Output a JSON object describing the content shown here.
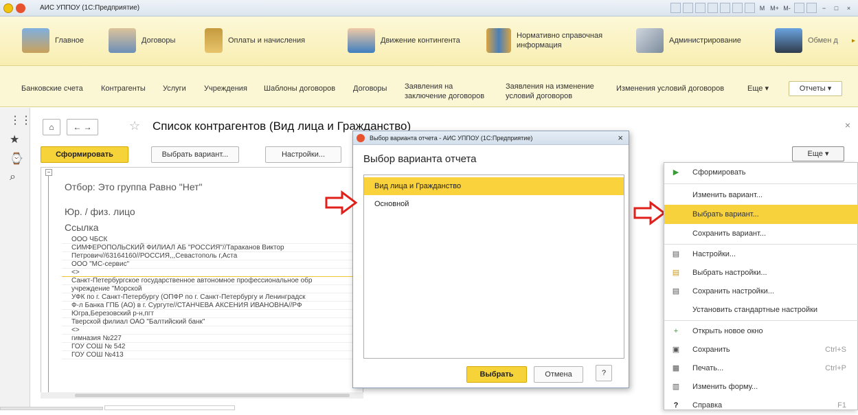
{
  "window": {
    "title": "АИС УППОУ  (1С:Предприятие)"
  },
  "toolbar_icons": [
    "M",
    "M+",
    "M-"
  ],
  "window_controls": [
    "−",
    "□",
    "×"
  ],
  "sections": [
    {
      "label": "Главное"
    },
    {
      "label": "Договоры"
    },
    {
      "label": "Оплаты и начисления"
    },
    {
      "label": "Движение контингента"
    },
    {
      "label": "Нормативно справочная информация"
    },
    {
      "label": "Администрирование"
    },
    {
      "label": "Обмен д"
    }
  ],
  "subnav": [
    {
      "label": "Банковские счета"
    },
    {
      "label": "Контрагенты"
    },
    {
      "label": "Услуги"
    },
    {
      "label": "Учреждения"
    },
    {
      "label": "Шаблоны договоров"
    },
    {
      "label": "Договоры"
    },
    {
      "label": "Заявления на заключение договоров"
    },
    {
      "label": "Заявления на изменение условий договоров"
    },
    {
      "label": "Изменения условий договоров"
    },
    {
      "label": "Еще ▾"
    }
  ],
  "reports_button": "Отчеты ▾",
  "form": {
    "title": "Список контрагентов (Вид лица и Гражданство)",
    "generate": "Сформировать",
    "choose_variant": "Выбрать вариант...",
    "settings": "Настройки...",
    "more": "Еще  ▾"
  },
  "report": {
    "filter": "Отбор:   Это группа Равно \"Нет\"",
    "col1": "Юр. / физ. лицо",
    "col2": "Ссылка",
    "rows": [
      "ООО ЧБСК",
      "СИМФЕРОПОЛЬСКИЙ ФИЛИАЛ АБ \"РОССИЯ\"//Тараканов Виктор",
      "Петрович//63164160//РОССИЯ,,,Севастополь г,Аста",
      "ООО \"МС-сервис\"",
      "<>",
      "Санкт-Петербургское государственное автономное профессиональное обр",
      "учреждение  \"Морской",
      "УФК по г. Санкт-Петербургу (ОПФР по г. Санкт-Петербургу и Ленинградск",
      "Ф-л Банка ГПБ (АО) в г. Сургуте//СТАНЧЕВА АКСЕНИЯ ИВАНОВНА//РФ",
      "Югра,Березовский р-н,пгт",
      "Тверской филиал ОАО \"Балтийский банк\"",
      "<>",
      "гимназия №227",
      "ГОУ СОШ № 542",
      "ГОУ СОШ №413"
    ]
  },
  "dialog": {
    "title": "Выбор варианта отчета - АИС УППОУ  (1С:Предприятие)",
    "heading": "Выбор варианта отчета",
    "items": [
      "Вид лица и Гражданство",
      "Основной"
    ],
    "select": "Выбрать",
    "cancel": "Отмена",
    "help": "?"
  },
  "context_menu": [
    {
      "label": "Сформировать",
      "icon": "▶",
      "key": ""
    },
    {
      "label": "Изменить вариант...",
      "icon": "",
      "key": ""
    },
    {
      "label": "Выбрать вариант...",
      "icon": "",
      "key": ""
    },
    {
      "label": "Сохранить вариант...",
      "icon": "",
      "key": ""
    },
    {
      "label": "Настройки...",
      "icon": "▤",
      "key": ""
    },
    {
      "label": "Выбрать настройки...",
      "icon": "▤",
      "key": ""
    },
    {
      "label": "Сохранить настройки...",
      "icon": "▤",
      "key": ""
    },
    {
      "label": "Установить стандартные настройки",
      "icon": "",
      "key": ""
    },
    {
      "label": "Открыть новое окно",
      "icon": "+",
      "key": ""
    },
    {
      "label": "Сохранить",
      "icon": "▣",
      "key": "Ctrl+S"
    },
    {
      "label": "Печать...",
      "icon": "▦",
      "key": "Ctrl+P"
    },
    {
      "label": "Изменить форму...",
      "icon": "▥",
      "key": ""
    },
    {
      "label": "Справка",
      "icon": "?",
      "key": "F1"
    }
  ],
  "colors": {
    "accent": "#f8d23d",
    "arrow": "#e0201b",
    "section_bg": "#fbf6d3"
  }
}
